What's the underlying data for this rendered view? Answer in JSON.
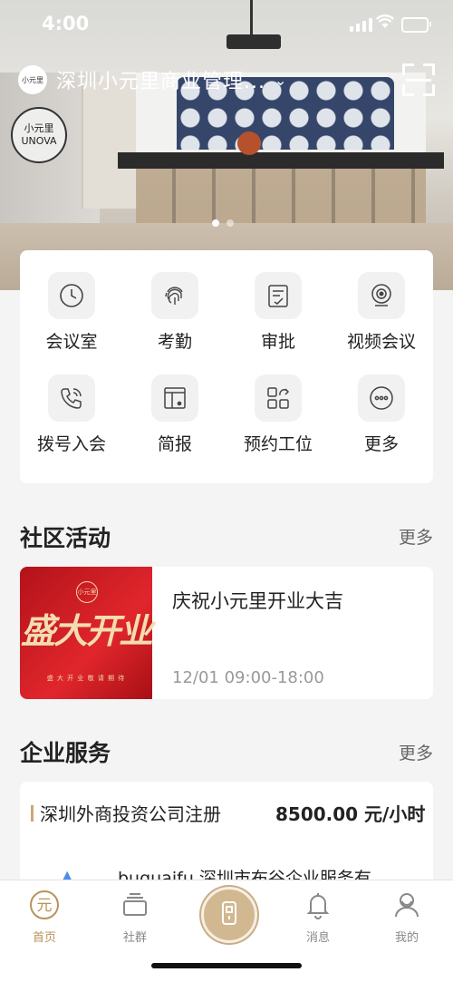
{
  "status": {
    "time": "4:00"
  },
  "header": {
    "org_name": "深圳小元里商业管理...",
    "org_logo_text": "小元里",
    "chevron": "⌄"
  },
  "hero": {
    "logo_line1": "小元里",
    "logo_line2": "UNOVA",
    "page_count": 2,
    "active_page": 1
  },
  "quick_actions": [
    {
      "label": "会议室",
      "icon": "clock-icon"
    },
    {
      "label": "考勤",
      "icon": "fingerprint-icon"
    },
    {
      "label": "审批",
      "icon": "approval-icon"
    },
    {
      "label": "视频会议",
      "icon": "webcam-icon"
    },
    {
      "label": "拨号入会",
      "icon": "phone-call-icon"
    },
    {
      "label": "简报",
      "icon": "report-icon"
    },
    {
      "label": "预约工位",
      "icon": "apps-grid-icon"
    },
    {
      "label": "更多",
      "icon": "more-icon"
    }
  ],
  "community": {
    "title": "社区活动",
    "more": "更多",
    "event": {
      "title": "庆祝小元里开业大吉",
      "time": "12/01 09:00-18:00",
      "image_badge": "小元里",
      "image_text": "盛大开业",
      "image_caption": "盛 大 开 业 敬 请 期 待"
    }
  },
  "services": {
    "title": "企业服务",
    "more": "更多",
    "item": {
      "name": "深圳外商投资公司注册",
      "price": "8500.00 元/小时",
      "provider": "buguaifu  深圳市布谷企业服务有"
    }
  },
  "tabbar": {
    "items": [
      {
        "label": "首页",
        "icon": "home-yuan-icon",
        "active": true
      },
      {
        "label": "社群",
        "icon": "community-icon",
        "active": false
      },
      {
        "label": "消息",
        "icon": "bell-icon",
        "active": false
      },
      {
        "label": "我的",
        "icon": "profile-icon",
        "active": false
      }
    ],
    "center_icon": "door-access-icon",
    "home_glyph": "元"
  },
  "colors": {
    "accent": "#b9935a",
    "event_red": "#c8161d"
  }
}
